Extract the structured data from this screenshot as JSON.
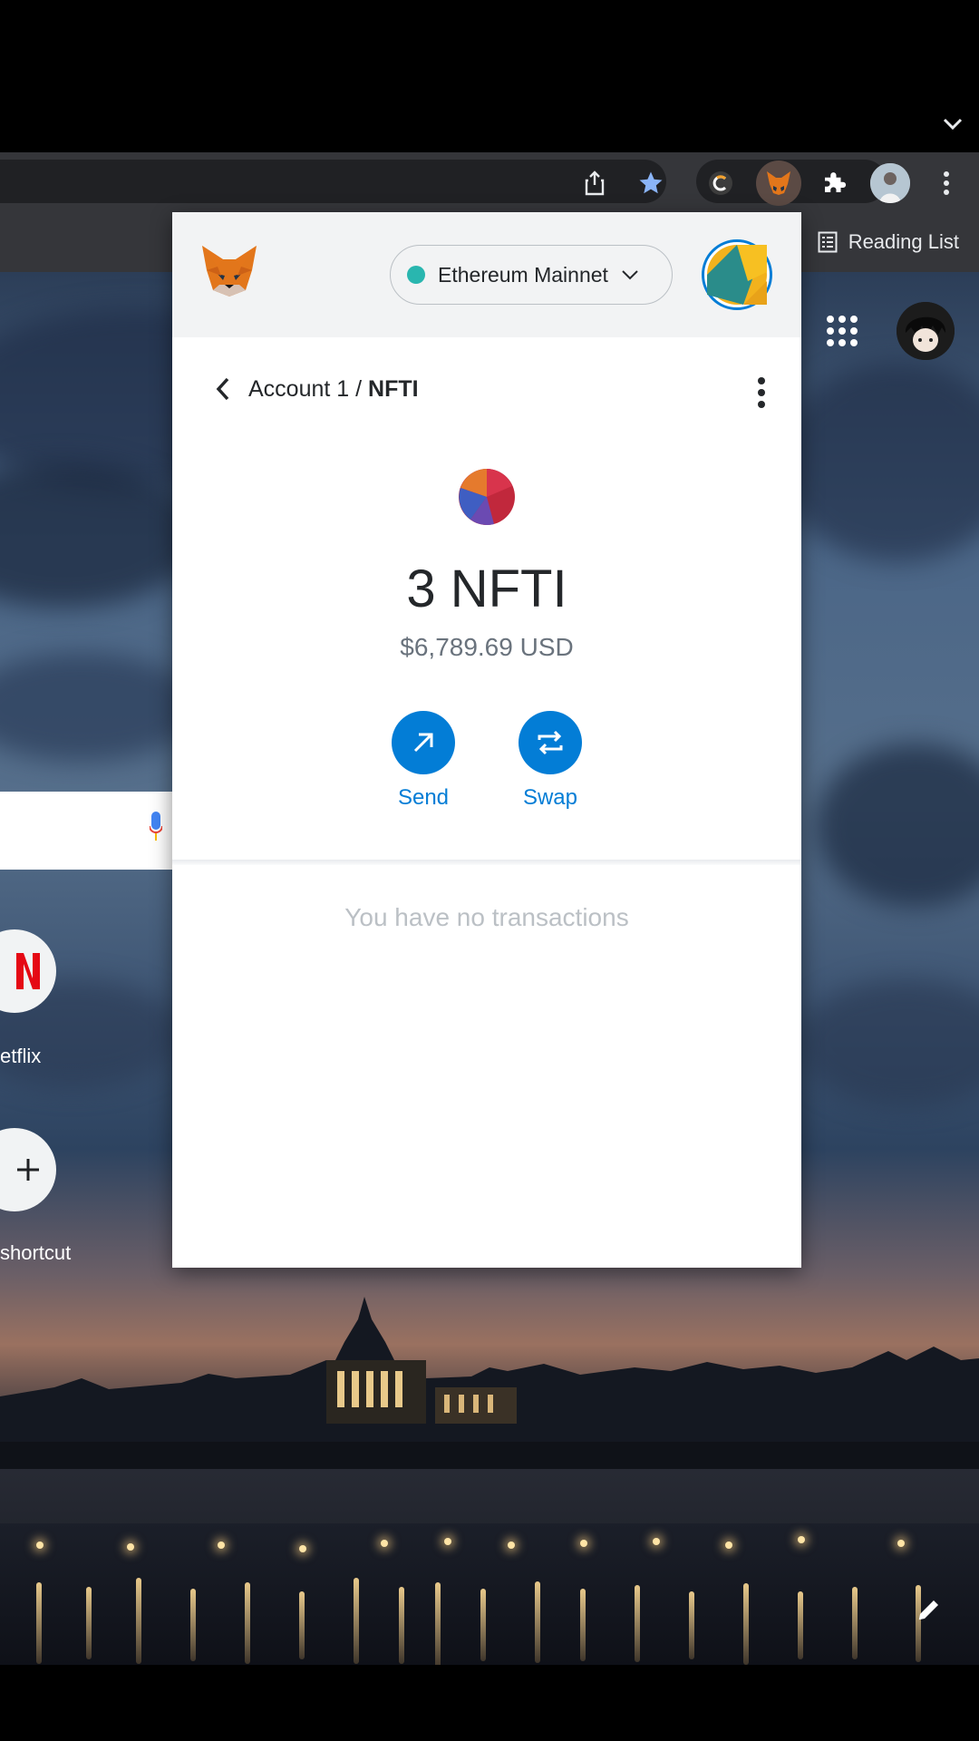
{
  "browser": {
    "reading_list_label": "Reading List",
    "toolbar_icons": [
      "share-icon",
      "star-icon",
      "extension-c-icon",
      "metamask-extension-icon",
      "puzzle-icon",
      "profile-avatar",
      "more-vert-icon"
    ],
    "accent_star": "#8ab4f8"
  },
  "ntp": {
    "shortcuts": [
      {
        "label": "etflix",
        "icon": "netflix-icon"
      },
      {
        "label": "shortcut",
        "icon": "plus-icon"
      }
    ]
  },
  "metamask": {
    "network": "Ethereum Mainnet",
    "network_color": "#29b6af",
    "breadcrumb": {
      "account": "Account 1 / ",
      "token": "NFTI"
    },
    "balance": "3 NFTI",
    "fiat_value": "$6,789.69 USD",
    "actions": [
      {
        "label": "Send",
        "icon": "arrow-up-right-icon"
      },
      {
        "label": "Swap",
        "icon": "swap-icon"
      }
    ],
    "empty_state": "You have no transactions",
    "accent": "#037dd6"
  }
}
